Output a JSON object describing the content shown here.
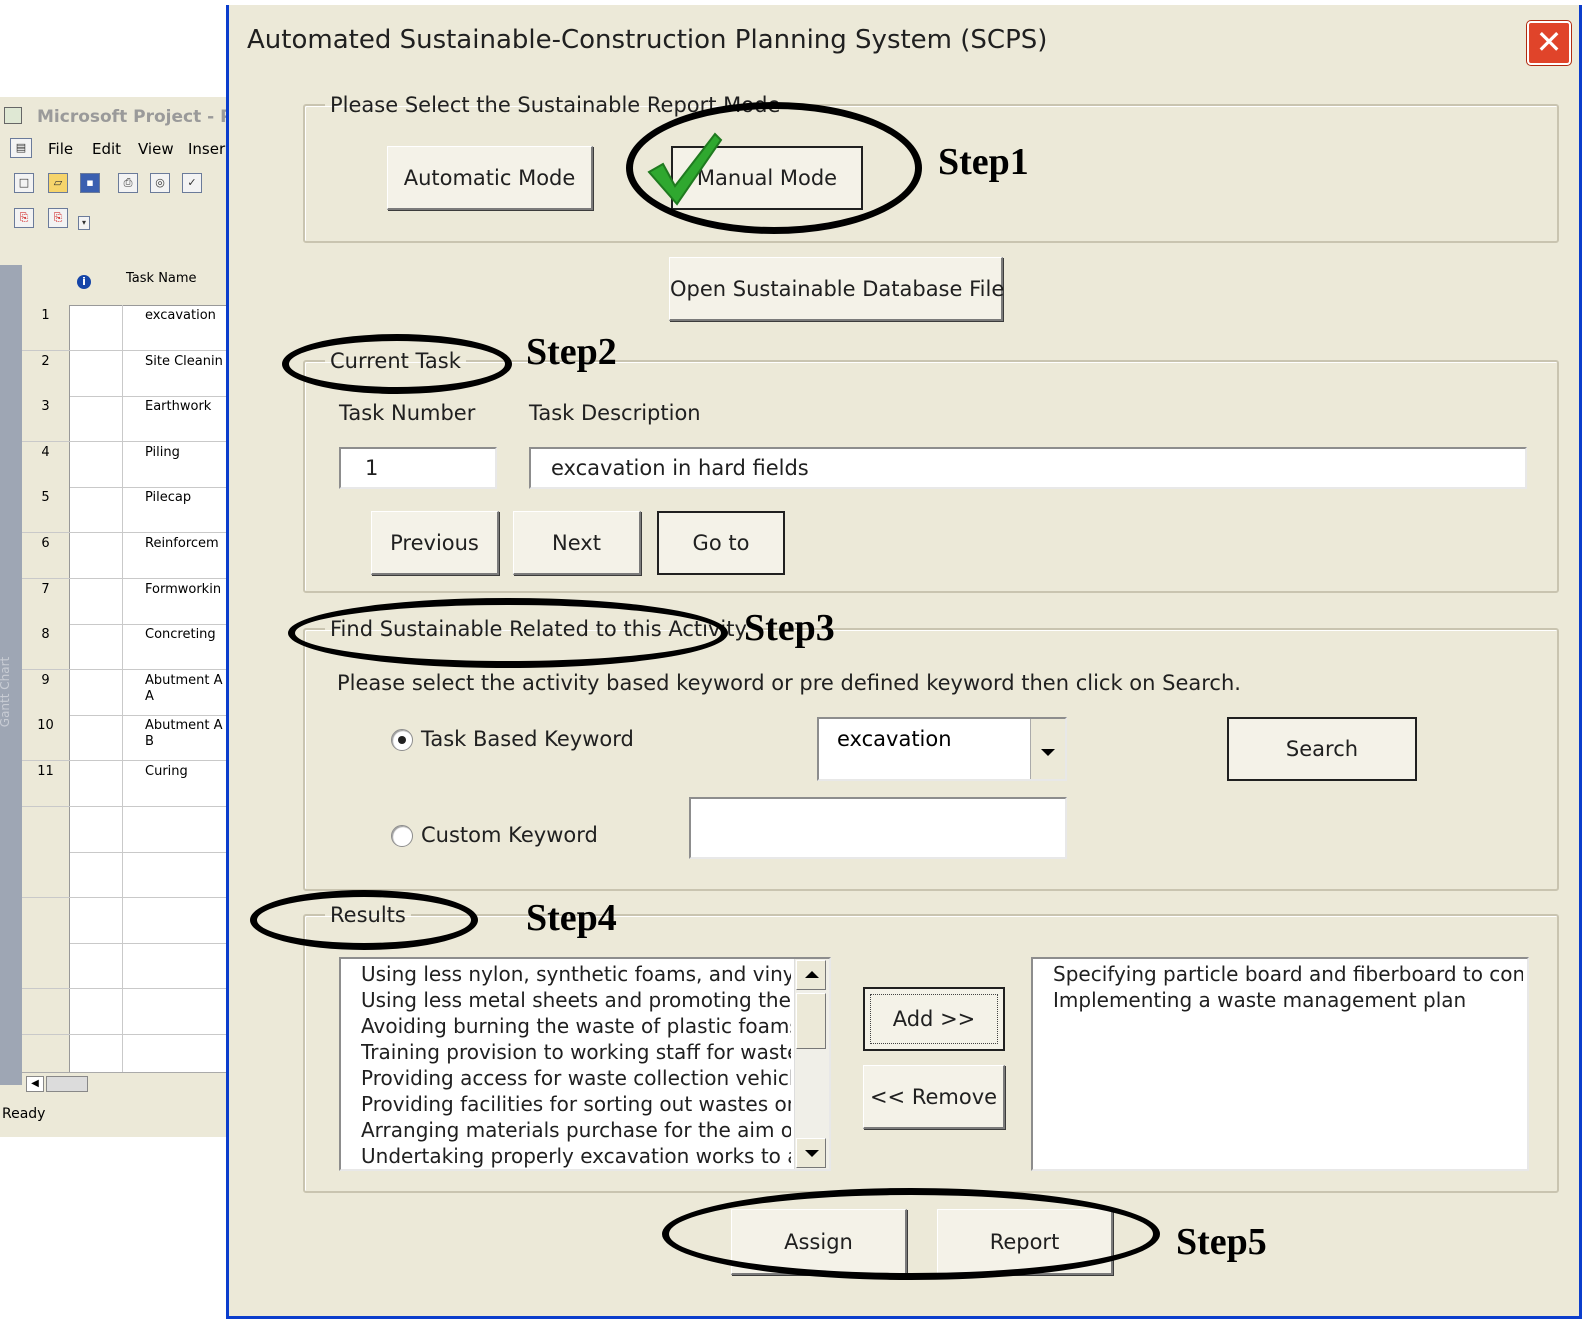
{
  "msproject": {
    "title": "Microsoft Project - Pro",
    "menu": [
      "File",
      "Edit",
      "View",
      "Inser"
    ],
    "task_name_header": "Task Name",
    "view_bar_label": "Gantt Chart",
    "rows": [
      {
        "id": "1",
        "name": "excavation"
      },
      {
        "id": "2",
        "name": "Site Cleanin"
      },
      {
        "id": "3",
        "name": "Earthwork"
      },
      {
        "id": "4",
        "name": "Piling"
      },
      {
        "id": "5",
        "name": "Pilecap"
      },
      {
        "id": "6",
        "name": "Reinforcem"
      },
      {
        "id": "7",
        "name": "Formworkin"
      },
      {
        "id": "8",
        "name": "Concreting"
      },
      {
        "id": "9",
        "name": "Abutment A\nA"
      },
      {
        "id": "10",
        "name": "Abutment A\nB"
      },
      {
        "id": "11",
        "name": "Curing"
      }
    ],
    "status": "Ready"
  },
  "dialog": {
    "title": "Automated Sustainable-Construction Planning System (SCPS)",
    "close_glyph": "✕",
    "mode_group": {
      "legend": "Please Select the Sustainable Report Mode",
      "automatic": "Automatic Mode",
      "manual": "Manual Mode"
    },
    "open_db": "Open Sustainable Database File",
    "current_task": {
      "legend": "Current Task",
      "task_number_label": "Task Number",
      "task_description_label": "Task Description",
      "task_number": "1",
      "task_description": "excavation in hard fields",
      "previous": "Previous",
      "next": "Next",
      "goto": "Go to"
    },
    "find": {
      "legend": "Find Sustainable Related to this Activity",
      "instruction": "Please select the activity based keyword or pre defined keyword then click on Search.",
      "task_based": "Task Based Keyword",
      "custom": "Custom Keyword",
      "keyword_value": "excavation",
      "custom_value": "",
      "search": "Search",
      "selected_option": "task_based"
    },
    "results": {
      "legend": "Results",
      "available": [
        "Using less nylon, synthetic foams, and vinyl/PVC",
        "Using less metal sheets and promoting the use",
        "Avoiding burning the waste of plastic foams, b",
        "Training provision to working staff for waste m",
        "Providing access for waste collection vehicles",
        "Providing facilities for sorting out wastes onsit",
        "Arranging materials purchase for the aim of w",
        "Undertaking properly excavation works to avo"
      ],
      "selected": [
        "Specifying particle board and fiberboard to conform",
        "Implementing a waste management plan"
      ],
      "add": "Add >>",
      "remove": "<< Remove"
    },
    "assign": "Assign",
    "report": "Report"
  },
  "annotations": {
    "step1": "Step1",
    "step2": "Step2",
    "step3": "Step3",
    "step4": "Step4",
    "step5": "Step5"
  },
  "colors": {
    "dialog_face": "#ece9d8",
    "title_border": "#0b3dcc",
    "close_button": "#e0442a",
    "checkmark": "#2fa82f"
  }
}
